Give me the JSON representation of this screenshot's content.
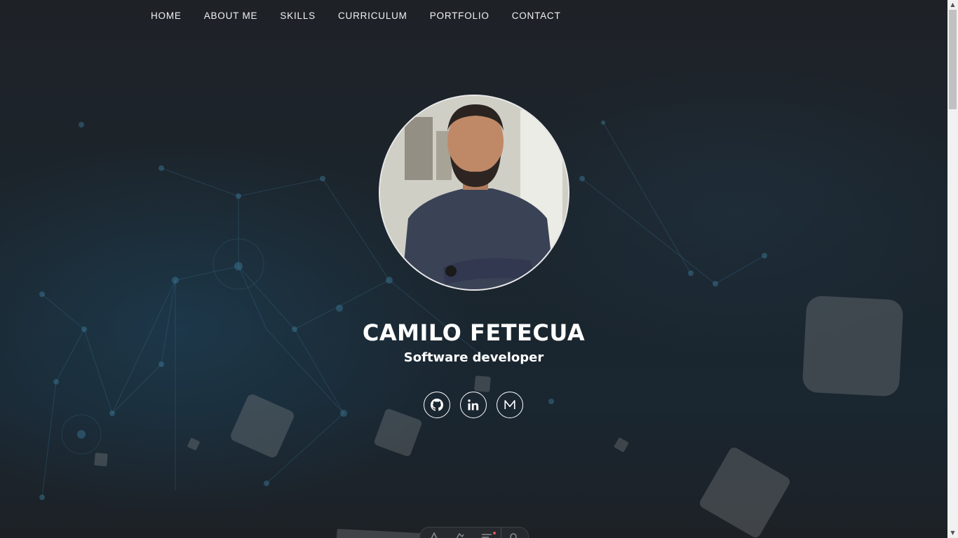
{
  "nav": {
    "items": [
      {
        "label": "HOME"
      },
      {
        "label": "ABOUT ME"
      },
      {
        "label": "SKILLS"
      },
      {
        "label": "CURRICULUM"
      },
      {
        "label": "PORTFOLIO"
      },
      {
        "label": "CONTACT"
      }
    ]
  },
  "hero": {
    "name": "CAMILO FETECUA",
    "role": "Software developer"
  },
  "socials": [
    {
      "icon": "github-icon"
    },
    {
      "icon": "linkedin-icon"
    },
    {
      "icon": "medium-icon"
    }
  ],
  "theme": {
    "background": "#1d2126",
    "text": "#ffffff",
    "accent_network": "#2f6f8f"
  }
}
